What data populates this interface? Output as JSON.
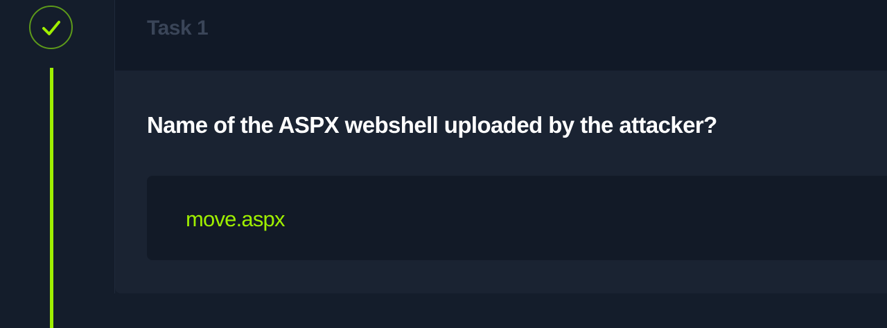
{
  "task": {
    "title": "Task 1",
    "status": "completed",
    "question": "Name of the ASPX webshell uploaded by the attacker?",
    "answer": "move.aspx"
  },
  "colors": {
    "accent": "#9fef00",
    "background": "#141d2b",
    "card_body": "#1a2332",
    "answer_box": "#121a27"
  },
  "icons": {
    "status": "checkmark-icon"
  }
}
